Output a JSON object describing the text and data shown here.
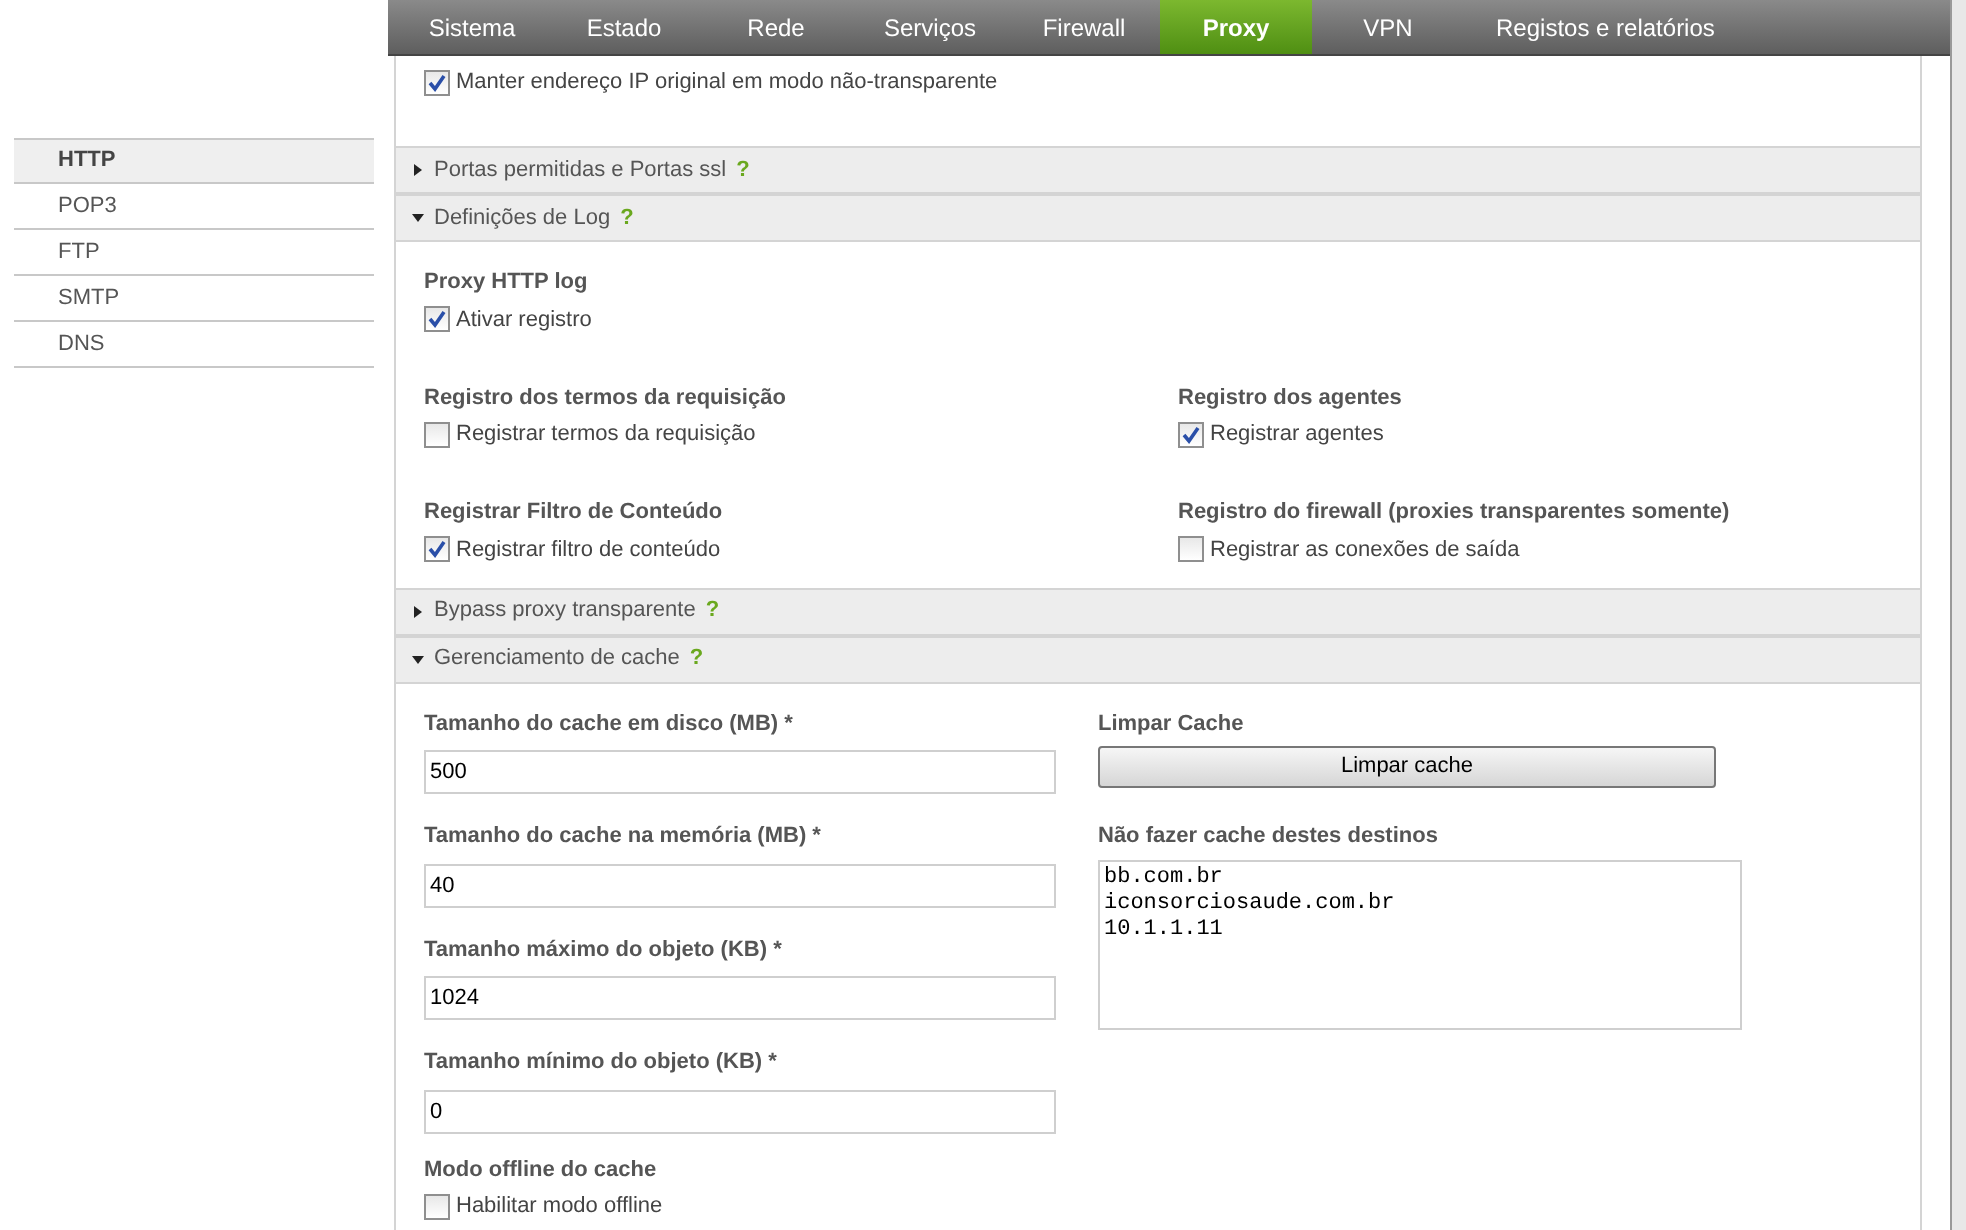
{
  "nav": [
    {
      "label": "Sistema",
      "selected": false
    },
    {
      "label": "Estado",
      "selected": false
    },
    {
      "label": "Rede",
      "selected": false
    },
    {
      "label": "Serviços",
      "selected": false
    },
    {
      "label": "Firewall",
      "selected": false
    },
    {
      "label": "Proxy",
      "selected": true
    },
    {
      "label": "VPN",
      "selected": false
    },
    {
      "label": "Registos e relatórios",
      "selected": false
    }
  ],
  "sidebar": [
    {
      "label": "HTTP",
      "selected": true
    },
    {
      "label": "POP3",
      "selected": false
    },
    {
      "label": "FTP",
      "selected": false
    },
    {
      "label": "SMTP",
      "selected": false
    },
    {
      "label": "DNS",
      "selected": false
    }
  ],
  "top_option": {
    "label": "Manter endereço IP original em modo não-transparente",
    "checked": true
  },
  "sections": [
    {
      "title": "Portas permitidas e Portas ssl",
      "help": "?",
      "expanded": false
    },
    {
      "kind": "log",
      "title": "Definições de Log",
      "help": "?",
      "expanded": true,
      "rows": [
        [
          {
            "title": "Proxy HTTP log",
            "option": {
              "label": "Ativar registro",
              "checked": true
            }
          }
        ],
        [
          {
            "title": "Registro dos termos da requisição",
            "option": {
              "label": "Registrar termos da requisição",
              "checked": false
            }
          },
          {
            "title": "Registro dos agentes",
            "option": {
              "label": "Registrar agentes",
              "checked": true
            }
          }
        ],
        [
          {
            "title": "Registrar Filtro de Conteúdo",
            "option": {
              "label": "Registrar filtro de conteúdo",
              "checked": true
            }
          },
          {
            "title": "Registro do firewall (proxies transparentes somente)",
            "option": {
              "label": "Registrar as conexões de saída",
              "checked": false
            }
          }
        ]
      ]
    },
    {
      "title": "Bypass proxy transparente",
      "help": "?",
      "expanded": false
    },
    {
      "kind": "cache",
      "title": "Gerenciamento de cache",
      "help": "?",
      "expanded": true,
      "fields": [
        {
          "label": "Tamanho do cache em disco (MB)",
          "required": "*",
          "value": "500"
        },
        {
          "label": "Tamanho do cache na memória (MB)",
          "required": "*",
          "value": "40"
        },
        {
          "label": "Tamanho máximo do objeto (KB)",
          "required": "*",
          "value": "1024"
        },
        {
          "label": "Tamanho mínimo do objeto (KB)",
          "required": "*",
          "value": "0"
        }
      ],
      "clear": {
        "title": "Limpar Cache",
        "button": "Limpar cache"
      },
      "exclusions": {
        "title": "Não fazer cache destes destinos",
        "value": "bb.com.br\niconsorciosaude.com.br\n10.1.1.11"
      },
      "offline": {
        "title": "Modo offline do cache",
        "option": {
          "label": "Habilitar modo offline",
          "checked": false
        }
      }
    }
  ]
}
